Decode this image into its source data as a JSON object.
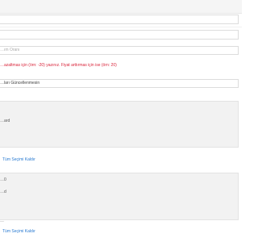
{
  "fields": {
    "ratio_placeholder": "…ım Oranı",
    "price_hint": "…azaltmas için (örn: -20) yazınız. Fiyat arttırmas için ise (örn: 20)",
    "update_select_value": "…ları Güncellenmesin"
  },
  "cards": [
    {
      "text_line": "…ard",
      "clear_link": "Tüm Seçimi Kaldır"
    },
    {
      "text_line_1": "…0",
      "text_line_2": "…d",
      "text_line_3": "…",
      "clear_link": "Tüm Seçimi Kaldır"
    }
  ],
  "colors": {
    "hint_red": "#d9243a",
    "link_blue": "#2a7bd1",
    "band_gray": "#f5f5f5"
  }
}
